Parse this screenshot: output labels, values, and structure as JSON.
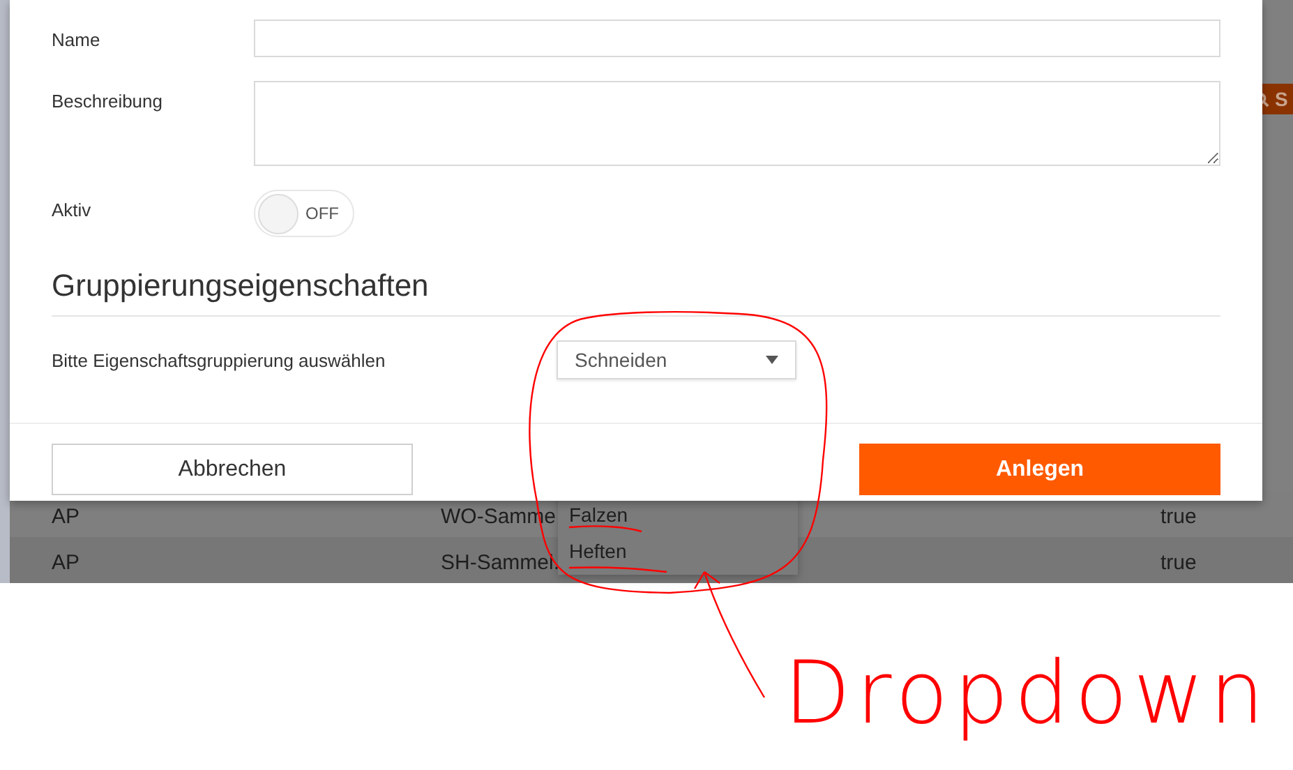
{
  "background": {
    "search_button": "S",
    "rows": [
      {
        "cells": [
          "AP",
          "WO-Samme",
          "true"
        ]
      },
      {
        "cells": [
          "AP",
          "SH-Sammel.",
          "true"
        ]
      }
    ]
  },
  "dropdown_options": [
    {
      "label": "Falzen"
    },
    {
      "label": "Heften"
    }
  ],
  "modal": {
    "fields": [
      {
        "label": "Name",
        "kind": "input"
      },
      {
        "label": "Beschreibung",
        "kind": "textarea"
      }
    ],
    "toggle": {
      "label": "Aktiv",
      "on": false,
      "text": "OFF"
    },
    "section_title": "Gruppierungseigenschaften",
    "select": {
      "label": "Bitte Eigenschaftsgruppierung auswählen",
      "value": "Schneiden"
    },
    "buttons": [
      {
        "label": "Abbrechen",
        "kind": "secondary"
      },
      {
        "label": "Anlegen",
        "kind": "primary"
      }
    ]
  },
  "annotation": {
    "text": "Dropdown"
  }
}
